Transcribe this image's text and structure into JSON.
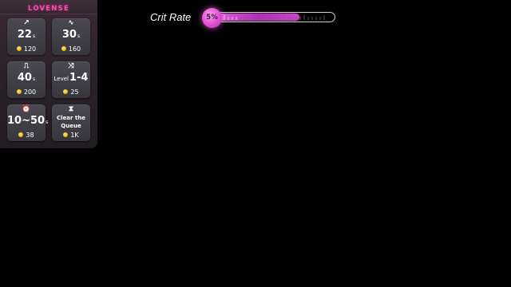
{
  "panel": {
    "brand": "LOVENSE",
    "tiles": [
      {
        "icon": "↗",
        "icon_name": "ramp-up-icon",
        "value": "22",
        "unit": "s",
        "price": "120"
      },
      {
        "icon": "∿",
        "icon_name": "wave-icon",
        "value": "30",
        "unit": "s",
        "price": "160"
      },
      {
        "icon": "⎍",
        "icon_name": "pulse-icon",
        "value": "40",
        "unit": "s",
        "price": "200"
      },
      {
        "icon": "⤨",
        "icon_name": "random-icon",
        "prefix": "Level",
        "value": "1-4",
        "price": "25"
      },
      {
        "icon": "⏰",
        "icon_name": "alarm-clock-icon",
        "value": "10~50",
        "unit": "s",
        "price": "38"
      },
      {
        "icon": "⧗",
        "icon_name": "hourglass-icon",
        "label": "Clear the Queue",
        "price": "1K"
      }
    ]
  },
  "crit": {
    "label": "Crit Rate",
    "value": "5%",
    "progress": 0.05
  },
  "colors": {
    "brand": "#ff4fb3",
    "accent": "#e65ad7",
    "coin": "#f0b81c",
    "background": "#000000"
  }
}
